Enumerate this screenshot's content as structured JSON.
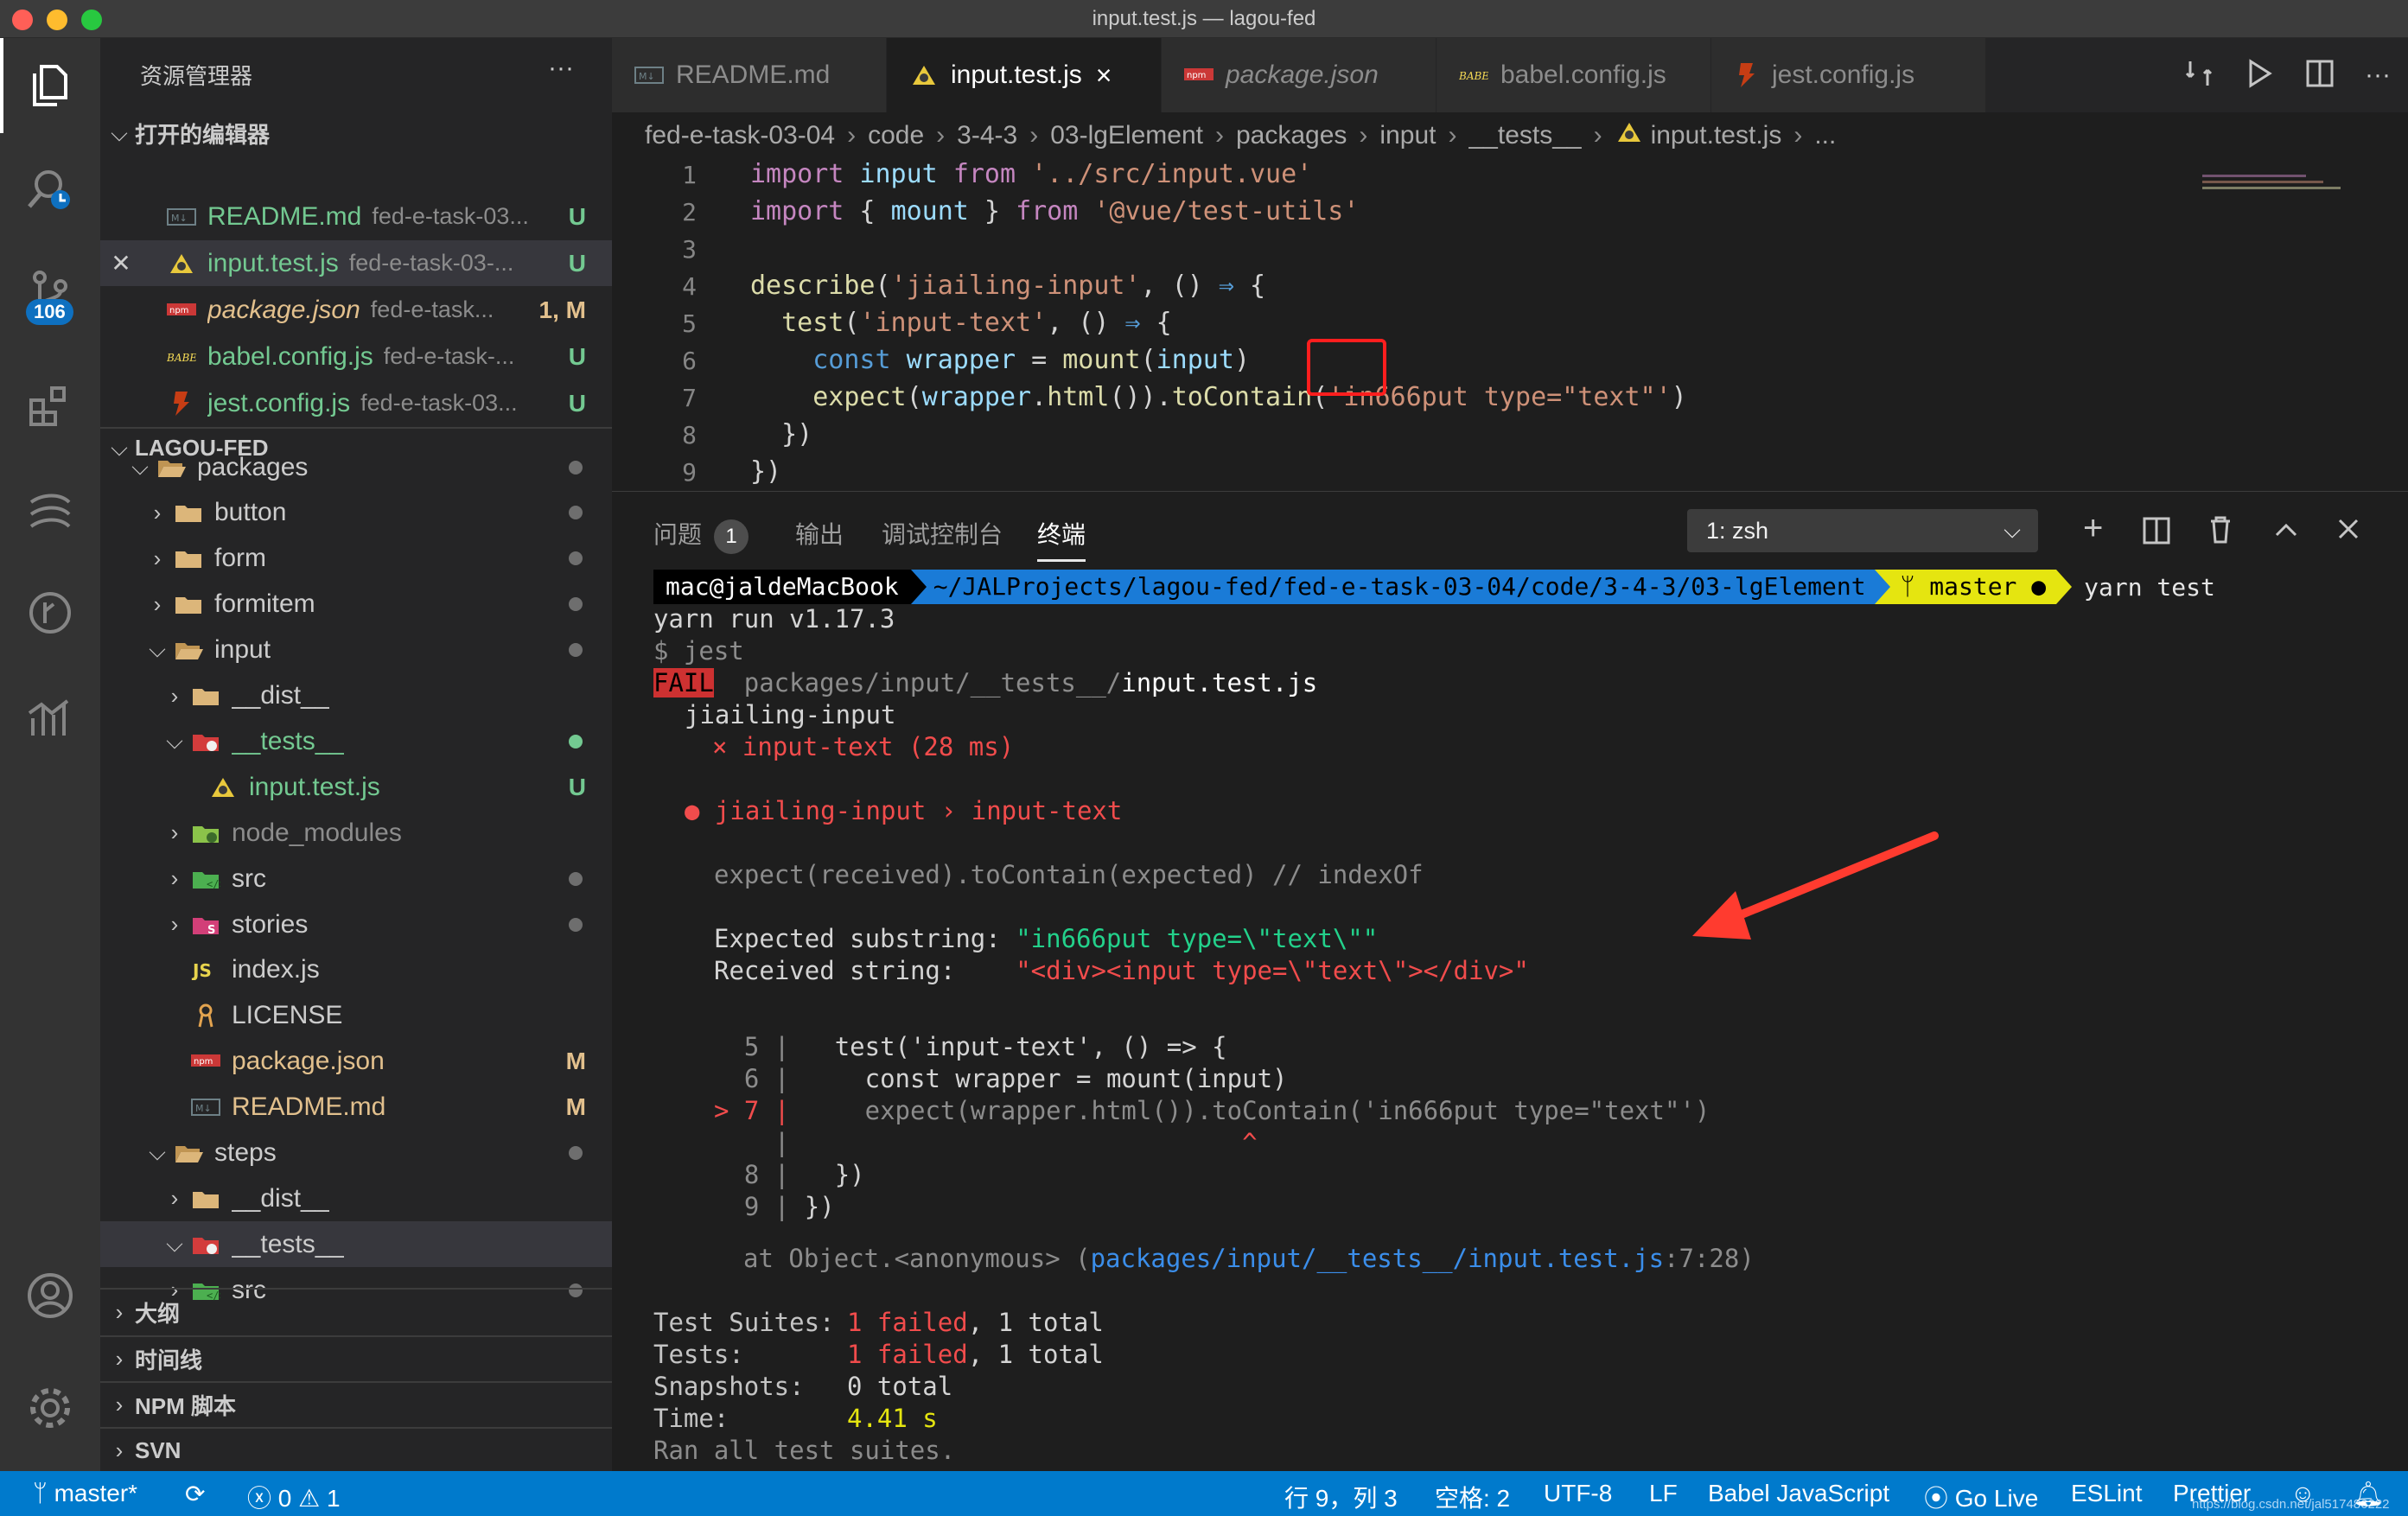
{
  "window": {
    "title": "input.test.js — lagou-fed"
  },
  "activity": {
    "scm_badge": "106"
  },
  "sidebar": {
    "title": "资源管理器",
    "more": "···",
    "open_editors": {
      "label": "打开的编辑器",
      "items": [
        {
          "name": "README.md",
          "path": "fed-e-task-03...",
          "status": "U"
        },
        {
          "name": "input.test.js",
          "path": "fed-e-task-03-...",
          "status": "U"
        },
        {
          "name": "package.json",
          "path": "fed-e-task...",
          "status": "1, M"
        },
        {
          "name": "babel.config.js",
          "path": "fed-e-task-...",
          "status": "U"
        },
        {
          "name": "jest.config.js",
          "path": "fed-e-task-03...",
          "status": "U"
        }
      ]
    },
    "workspace": {
      "label": "LAGOU-FED",
      "tree": [
        {
          "name": "packages"
        },
        {
          "name": "button"
        },
        {
          "name": "form"
        },
        {
          "name": "formitem"
        },
        {
          "name": "input"
        },
        {
          "name": "__dist__"
        },
        {
          "name": "__tests__"
        },
        {
          "name": "input.test.js",
          "status": "U"
        },
        {
          "name": "node_modules"
        },
        {
          "name": "src"
        },
        {
          "name": "stories"
        },
        {
          "name": "index.js"
        },
        {
          "name": "LICENSE"
        },
        {
          "name": "package.json",
          "status": "M"
        },
        {
          "name": "README.md",
          "status": "M"
        },
        {
          "name": "steps"
        },
        {
          "name": "__dist__"
        },
        {
          "name": "__tests__"
        },
        {
          "name": "src"
        }
      ]
    },
    "sections": [
      "大纲",
      "时间线",
      "NPM 脚本",
      "SVN"
    ]
  },
  "tabs": [
    {
      "label": "README.md",
      "icon": "markdown-icon"
    },
    {
      "label": "input.test.js",
      "icon": "test-file-icon",
      "active": true,
      "close": "×"
    },
    {
      "label": "package.json",
      "icon": "npm-icon"
    },
    {
      "label": "babel.config.js",
      "icon": "babel-icon"
    },
    {
      "label": "jest.config.js",
      "icon": "jest-icon"
    }
  ],
  "breadcrumb": [
    "fed-e-task-03-04",
    "code",
    "3-4-3",
    "03-lgElement",
    "packages",
    "input",
    "__tests__",
    "input.test.js",
    "..."
  ],
  "editor": {
    "line_numbers": [
      "1",
      "2",
      "3",
      "4",
      "5",
      "6",
      "7",
      "8",
      "9"
    ],
    "lines": [
      "import input from '../src/input.vue'",
      "import { mount } from '@vue/test-utils'",
      "",
      "describe('jiailing-input', () => {",
      "  test('input-text', () => {",
      "    const wrapper = mount(input)",
      "    expect(wrapper.html()).toContain('in666put type=\"text\"')",
      "  })",
      "})"
    ]
  },
  "panel": {
    "tabs": [
      "问题",
      "输出",
      "调试控制台",
      "终端"
    ],
    "problems_count": "1",
    "terminal_select": "1: zsh",
    "prompt": {
      "user": "mac@jaldeMacBook",
      "path": "~/JALProjects/lagou-fed/fed-e-task-03-04/code/3-4-3/03-lgElement",
      "branch": "master ●",
      "command": "yarn test"
    },
    "terminal": {
      "yarn_run": "yarn run v1.17.3",
      "jest_cmd": "$ jest",
      "fail_badge": "FAIL",
      "fail_dir": "packages/input/__tests__/",
      "fail_file": "input.test.js",
      "suite": "jiailing-input",
      "test_line": "× input-text (28 ms)",
      "bullet_title": "● jiailing-input › input-text",
      "expect_line": "expect(received).toContain(expected) // indexOf",
      "expected_label": "Expected substring:",
      "expected_value": "\"in666put type=\\\"text\\\"\"",
      "received_label": "Received string:",
      "received_value": "\"<div><input type=\\\"text\\\"></div>\"",
      "snippet": [
        {
          "gutter": "  5 |",
          "code": "  test('input-text', () => {"
        },
        {
          "gutter": "  6 |",
          "code": "    const wrapper = mount(input)"
        },
        {
          "gutter": "> 7 |",
          "code": "    expect(wrapper.html()).toContain('in666put type=\"text\"')"
        },
        {
          "gutter": "    |",
          "code": "                             ^"
        },
        {
          "gutter": "  8 |",
          "code": "  })"
        },
        {
          "gutter": "  9 |",
          "code": "})"
        }
      ],
      "at_prefix": "at Object.<anonymous> (",
      "at_path": "packages/input/__tests__/input.test.js",
      "at_suffix": ":7:28)",
      "summary": [
        {
          "label": "Test Suites:",
          "fail": "1 failed",
          "rest": ", 1 total"
        },
        {
          "label": "Tests:",
          "fail": "1 failed",
          "rest": ", 1 total"
        },
        {
          "label": "Snapshots:",
          "fail": "",
          "rest": "0 total"
        },
        {
          "label": "Time:",
          "fail": "",
          "rest": "4.41 s"
        }
      ],
      "ran_all": "Ran all test suites."
    }
  },
  "statusbar": {
    "branch": "master*",
    "errors": "0",
    "warnings": "1",
    "position": "行 9，列 3",
    "spaces": "空格: 2",
    "encoding": "UTF-8",
    "eol": "LF",
    "language": "Babel JavaScript",
    "golive": "Go Live",
    "eslint": "ESLint",
    "prettier": "Prettier",
    "watermark": "https://blog.csdn.net/jal517486222"
  },
  "colors": {
    "accent": "#007acc",
    "error": "#f14c4c",
    "success": "#23d18b",
    "annotation": "#ff1e1e"
  }
}
